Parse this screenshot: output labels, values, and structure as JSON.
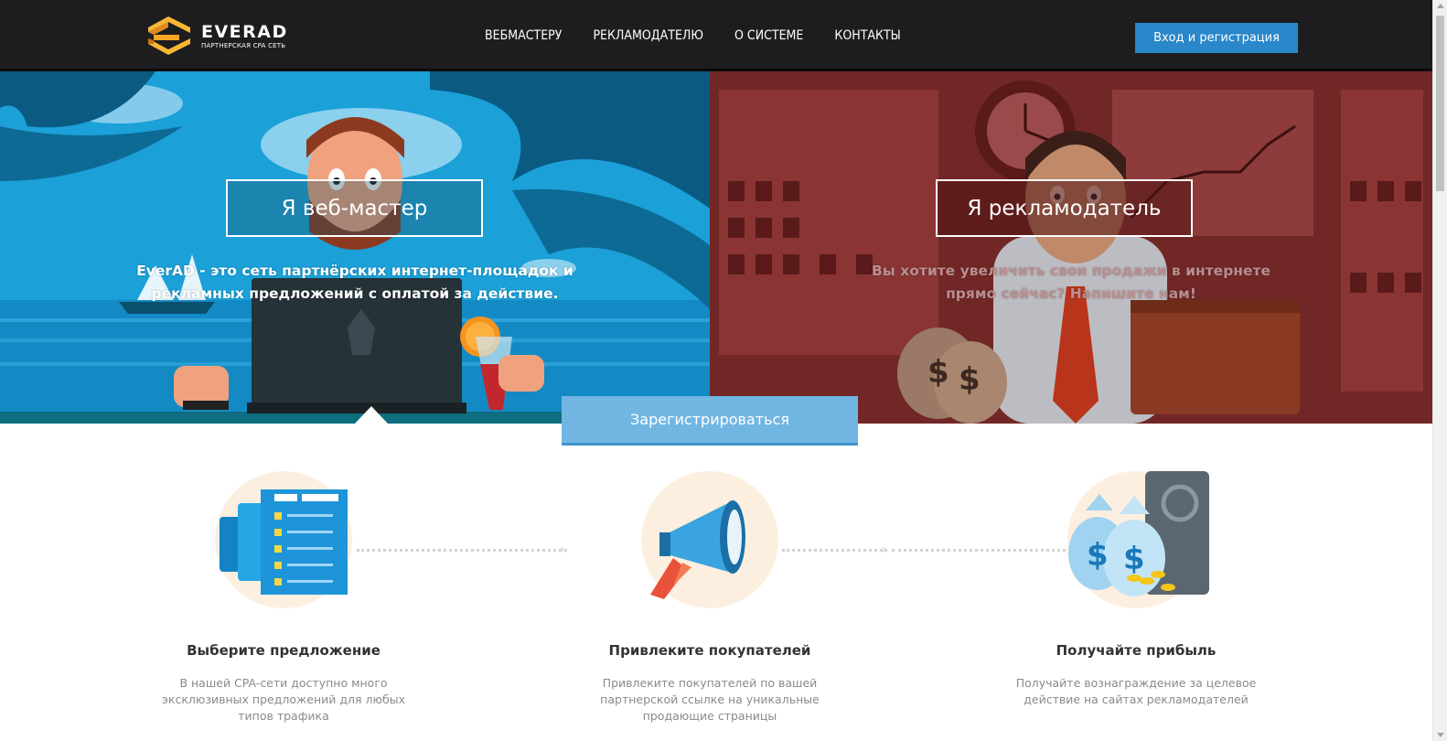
{
  "header": {
    "logo_text": "EVERAD",
    "logo_subtitle": "ПАРТНЕРСКАЯ CPA СЕТЬ",
    "nav": [
      {
        "label": "ВЕБМАСТЕРУ"
      },
      {
        "label": "РЕКЛАМОДАТЕЛЮ"
      },
      {
        "label": "О СИСТЕМЕ"
      },
      {
        "label": "КОНТАКТЫ"
      }
    ],
    "login_label": "Вход и регистрация"
  },
  "hero": {
    "left": {
      "title": "Я веб-мастер",
      "text_line1": "EverAD - это сеть партнёрских интернет-площадок и",
      "text_line2": "рекламных предложений с оплатой за действие."
    },
    "right": {
      "title": "Я рекламодатель",
      "text_line1": "Вы хотите увеличить свои продажи в интернете",
      "text_line2": "прямо сейчас? Напишите нам!"
    },
    "register_label": "Зарегистрироваться"
  },
  "steps": [
    {
      "title": "Выберите предложение",
      "desc": "В нашей CPA-сети доступно много эксклюзивных предложений для любых типов трафика",
      "icon": "document-list-icon"
    },
    {
      "title": "Привлеките покупателей",
      "desc": "Привлеките покупателей по вашей партнерской ссылке на уникальные продающие страницы",
      "icon": "megaphone-icon"
    },
    {
      "title": "Получайте прибыль",
      "desc": "Получайте вознаграждение за целевое действие на сайтах рекламодателей",
      "icon": "money-bags-icon"
    }
  ],
  "colors": {
    "header_bg": "#1d1d1f",
    "accent_blue": "#2a87c9",
    "register_bg": "#71b6e3",
    "hero_left_bg": "#1b9fd6",
    "hero_right_bg": "#6b2424",
    "logo_orange": "#f5a623"
  }
}
